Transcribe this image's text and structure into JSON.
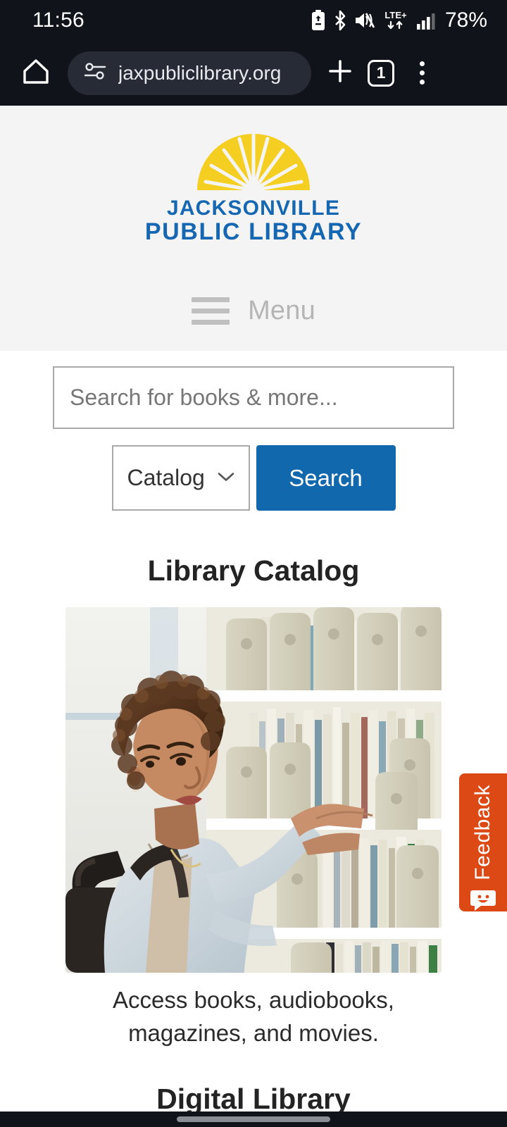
{
  "status_bar": {
    "clock": "11:56",
    "battery_percent": "78%",
    "network_type": "LTE+",
    "icons": [
      "battery-saver-icon",
      "bluetooth-icon",
      "mute-vibrate-icon",
      "lte-data-icon",
      "signal-bars-icon"
    ]
  },
  "browser": {
    "home_icon": "home-icon",
    "site_settings_icon": "site-settings-tune-icon",
    "url": "jaxpubliclibrary.org",
    "new_tab_label": "+",
    "tab_count": "1",
    "menu_icon": "three-dot-menu-icon"
  },
  "site": {
    "logo_line1": "JACKSONVILLE",
    "logo_line2": "PUBLIC LIBRARY",
    "logo_icon": "sunburst-logo-icon",
    "menu_label": "Menu",
    "menu_icon": "hamburger-icon"
  },
  "search": {
    "placeholder": "Search for books & more...",
    "value": "",
    "scope_selected": "Catalog",
    "scope_options": [
      "Catalog"
    ],
    "button_label": "Search"
  },
  "sections": [
    {
      "title": "Library Catalog",
      "caption": "Access books, audiobooks, magazines, and movies.",
      "image_alt": "woman browsing library bookshelves"
    },
    {
      "title": "Digital Library",
      "caption": "",
      "image_alt": ""
    }
  ],
  "feedback": {
    "label": "Feedback",
    "icon": "smiley-speech-bubble-icon",
    "color": "#dd4914"
  },
  "colors": {
    "brand_blue": "#1168ad",
    "logo_blue": "#1667b1",
    "logo_yellow": "#f4cf22",
    "header_bg": "#f4f4f4",
    "chrome_dark": "#10131a",
    "feedback_orange": "#dd4914"
  },
  "nav_bar": {
    "home_indicator": "home-gesture-pill"
  }
}
